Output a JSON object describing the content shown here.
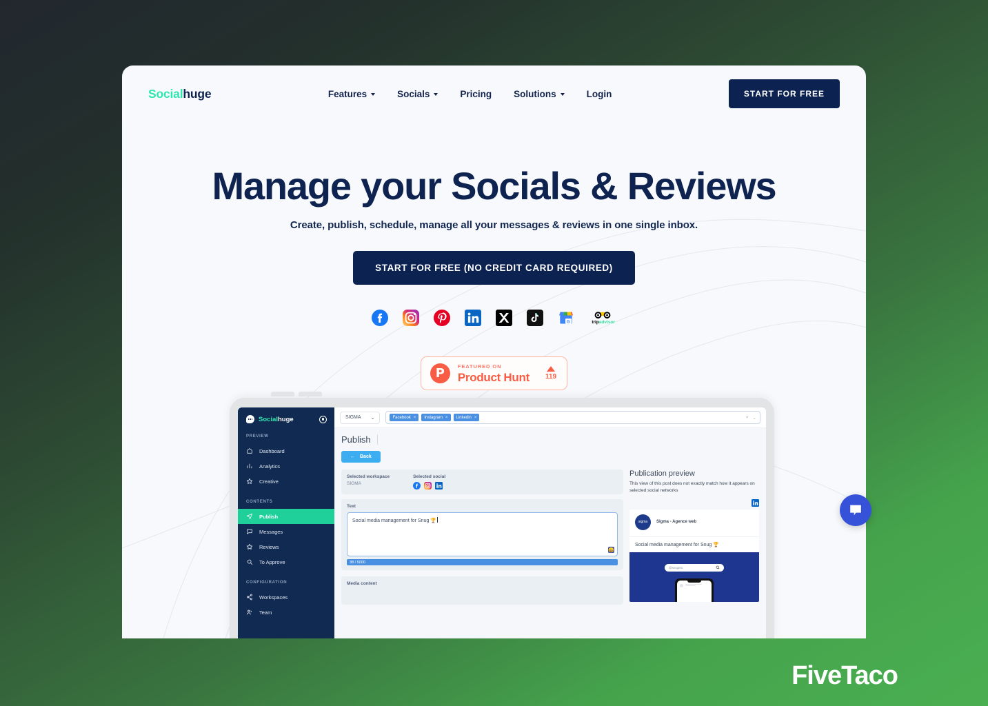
{
  "brand": {
    "name_part1": "Social",
    "name_part2": "huge"
  },
  "nav": {
    "links": [
      {
        "label": "Features",
        "has_caret": true
      },
      {
        "label": "Socials",
        "has_caret": true
      },
      {
        "label": "Pricing",
        "has_caret": false
      },
      {
        "label": "Solutions",
        "has_caret": true
      },
      {
        "label": "Login",
        "has_caret": false
      }
    ],
    "cta": "START FOR FREE"
  },
  "hero": {
    "title": "Manage your Socials & Reviews",
    "subtitle": "Create, publish, schedule, manage all your messages & reviews in one single inbox.",
    "cta": "START FOR FREE (NO CREDIT CARD REQUIRED)",
    "social_icons": [
      "facebook-icon",
      "instagram-icon",
      "pinterest-icon",
      "linkedin-icon",
      "x-twitter-icon",
      "tiktok-icon",
      "google-business-icon",
      "tripadvisor-icon"
    ]
  },
  "product_hunt": {
    "featured_on": "FEATURED ON",
    "name": "Product Hunt",
    "votes": "119",
    "letter": "P"
  },
  "app": {
    "logo_part1": "Social",
    "logo_part2": "huge",
    "sidebar": [
      {
        "type": "section",
        "label": "PREVIEW"
      },
      {
        "type": "item",
        "label": "Dashboard",
        "icon": "home-icon",
        "active": false
      },
      {
        "type": "item",
        "label": "Analytics",
        "icon": "bar-chart-icon",
        "active": false
      },
      {
        "type": "item",
        "label": "Creative",
        "icon": "star-icon",
        "active": false
      },
      {
        "type": "section",
        "label": "CONTENTS"
      },
      {
        "type": "item",
        "label": "Publish",
        "icon": "send-icon",
        "active": true
      },
      {
        "type": "item",
        "label": "Messages",
        "icon": "chat-icon",
        "active": false
      },
      {
        "type": "item",
        "label": "Reviews",
        "icon": "star-icon",
        "active": false
      },
      {
        "type": "item",
        "label": "To Approve",
        "icon": "search-icon",
        "active": false
      },
      {
        "type": "section",
        "label": "CONFIGURATION"
      },
      {
        "type": "item",
        "label": "Workspaces",
        "icon": "share-icon",
        "active": false
      },
      {
        "type": "item",
        "label": "Team",
        "icon": "users-icon",
        "active": false
      }
    ],
    "topbar": {
      "workspace": "SIGMA",
      "tags": [
        "Facebook",
        "Instagram",
        "Linkedin"
      ],
      "clear_label": "×",
      "caret_label": "⌄"
    },
    "page_title": "Publish",
    "back_label": "Back",
    "selected_workspace_label": "Selected workspace",
    "selected_workspace_value": "SIGMA",
    "selected_social_label": "Selected social",
    "selected_social_icons": [
      "facebook-icon",
      "instagram-icon",
      "linkedin-icon"
    ],
    "text_label": "Text",
    "text_value": "Social media management for Snug 🏆",
    "counter": "38 / 5000",
    "media_label": "Media content",
    "preview": {
      "heading": "Publication preview",
      "description": "This view of this post does not exactly match how it appears on selected social networks",
      "network_icon": "linkedin-icon",
      "account_name": "Sigma - Agence web",
      "avatar_text": "sigma",
      "post_text": "Social media management for Snug 🏆",
      "image_search_placeholder": "@snugieu"
    }
  },
  "chat_widget": {
    "icon": "chat-bubble-icon"
  },
  "watermark": "FiveTaco"
}
